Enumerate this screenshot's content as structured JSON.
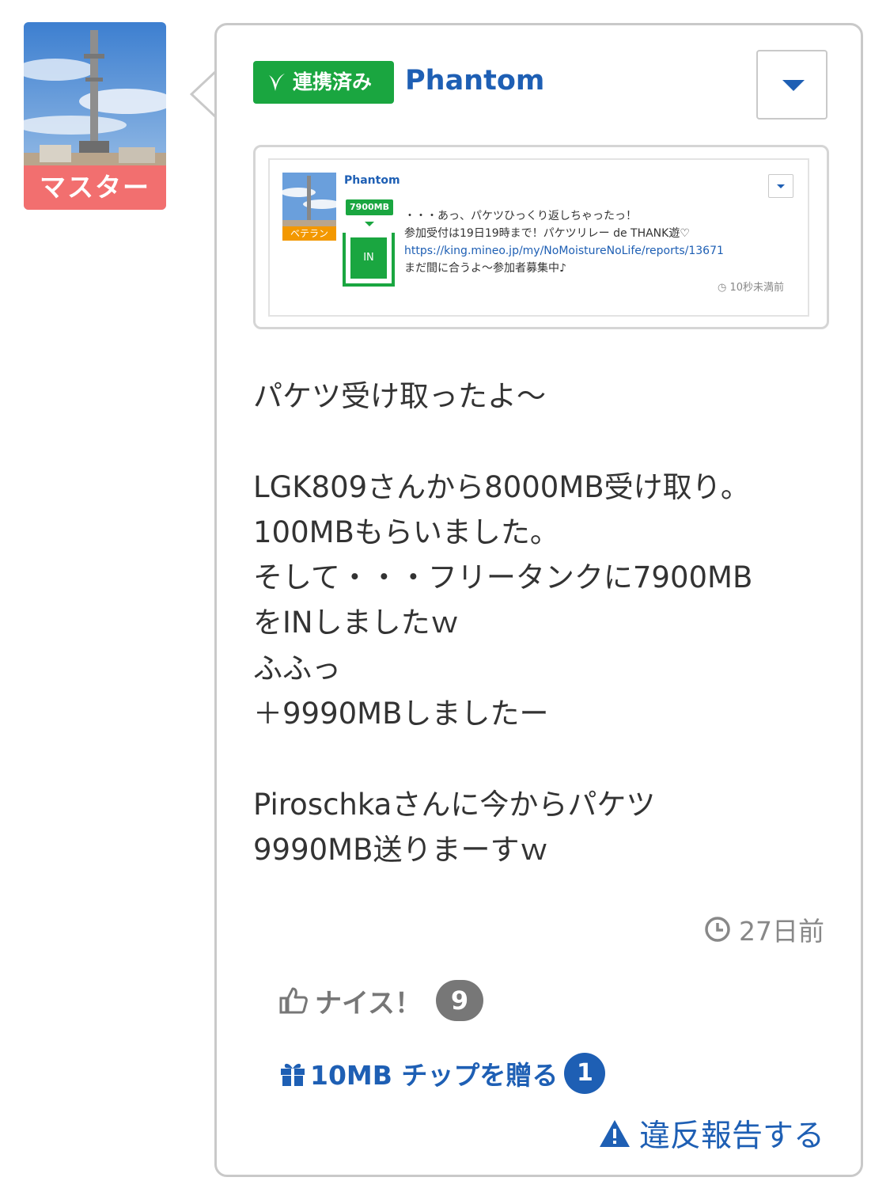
{
  "author": {
    "rank_badge": "マスター"
  },
  "post": {
    "linked_badge": "連携済み",
    "user_name": "Phantom",
    "body": "パケツ受け取ったよ～\n\nLGK809さんから8000MB受け取り。\n100MBもらいました。\nそして・・・フリータンクに7900MB\nをINしましたｗ\nふふっ\n＋9990MBしましたー\n\nPiroschkaさんに今からパケツ\n9990MB送りまーすｗ",
    "time": "27日前",
    "nice_label": "ナイス！",
    "nice_count": "9",
    "tip_label": "10MB チップを贈る",
    "tip_count": "1",
    "report_label": "違反報告する"
  },
  "embedded": {
    "user_name": "Phantom",
    "rank_badge": "ベテラン",
    "tank_amount": "7900MB",
    "tank_label": "IN",
    "line1": "・・・あっ、パケツひっくり返しちゃったっ！",
    "line2": "参加受付は19日19時まで！パケツリレー de THANK遊♡",
    "link": "https://king.mineo.jp/my/NoMoistureNoLife/reports/13671",
    "line4": "まだ間に合うよ～参加者募集中♪",
    "time": "10秒未満前"
  },
  "colors": {
    "accent": "#1e5fb4",
    "linked_green": "#1aa640",
    "master_badge": "#f26f6f",
    "veteran_badge": "#f39800"
  }
}
